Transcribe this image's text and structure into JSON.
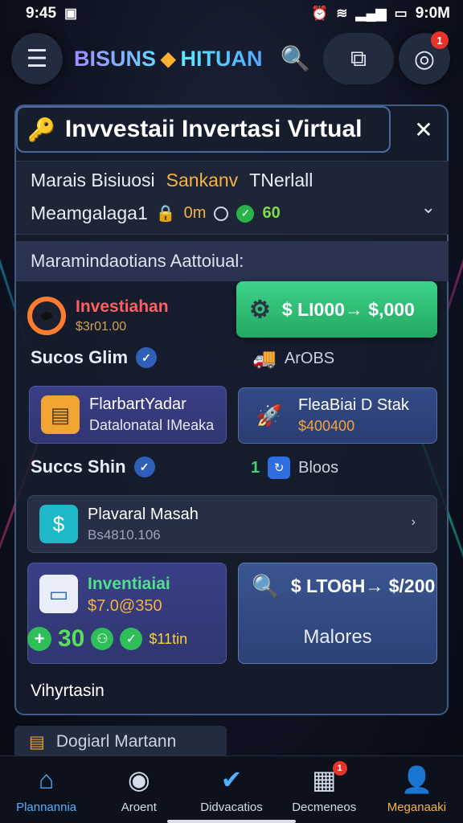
{
  "status_bar": {
    "time": "9:45",
    "right_time": "9:0M"
  },
  "header": {
    "brand_left": "BISUNS",
    "brand_right": "HITUAN",
    "notification_count": "1"
  },
  "modal": {
    "title": "Invvestaii Invertasi Virtual",
    "account": {
      "label": "Marais Bisiuosi",
      "accent": "Sankanv",
      "extra": "TNerlall",
      "name": "Meamgalaga1",
      "timer": "0m",
      "score": "60"
    },
    "section_title": "Maramindaotians Aattoiual:",
    "investment1": {
      "title": "Investiahan",
      "amount": "$3r01.00"
    },
    "cta1": {
      "label": "$ LI000→ $,000"
    },
    "row1_left": {
      "label": "Sucos Glim"
    },
    "row1_right": {
      "label": "ArOBS"
    },
    "card_left1": {
      "title": "FlarbartYadar",
      "subtitle": "Datalonatal IMeaka"
    },
    "card_right1": {
      "title": "FleaBiai D Stak",
      "amount": "$400400"
    },
    "row2_left": {
      "label": "Succs Shin"
    },
    "row2_right": {
      "count": "1",
      "label": "Bloos"
    },
    "wide_card": {
      "title": "Plavaral Masah",
      "subtitle": "Bs4810.106"
    },
    "card_left2": {
      "title": "Inventiaiai",
      "amount": "$7.0@350"
    },
    "stats": {
      "count": "30",
      "label": "$11tin"
    },
    "cta2": {
      "label": "$ LTO6H→ $/200",
      "sub": "Malores"
    },
    "footer_label": "Vihyrtasin"
  },
  "peek_card": {
    "label": "Dogiarl Martann"
  },
  "bottom_nav": [
    {
      "label": "Plannannia",
      "icon": "home-icon"
    },
    {
      "label": "Aroent",
      "icon": "person-badge-icon"
    },
    {
      "label": "Didvacatios",
      "icon": "check-circle-icon"
    },
    {
      "label": "Decmeneos",
      "icon": "document-icon",
      "badge": "1"
    },
    {
      "label": "Meganaaki",
      "icon": "user-icon"
    }
  ]
}
